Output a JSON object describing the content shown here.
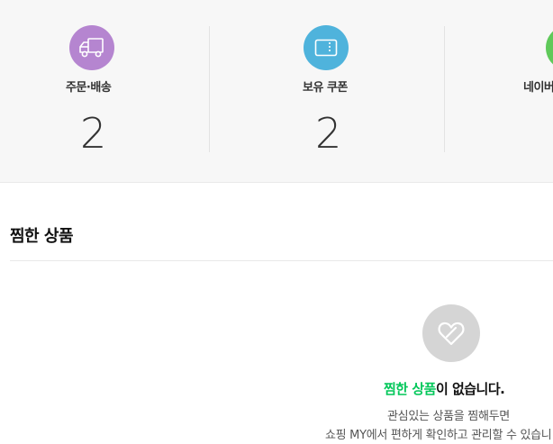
{
  "summary": {
    "items": [
      {
        "label": "주문·배송",
        "count": "2",
        "icon": "truck-icon",
        "color": "#b585d0"
      },
      {
        "label": "보유 쿠폰",
        "count": "2",
        "icon": "coupon-icon",
        "color": "#4fb3dc"
      },
      {
        "label": "네이버",
        "icon": "circle-icon",
        "color": "#5fc95a"
      }
    ]
  },
  "wishlist": {
    "title": "찜한 상품",
    "empty": {
      "icon": "heart-icon",
      "heading_accent": "찜한 상품",
      "heading_rest": "이 없습니다.",
      "line1": "관심있는 상품을 찜해두면",
      "line2": "쇼핑 MY에서 편하게 확인하고 관리할 수 있습니"
    }
  }
}
